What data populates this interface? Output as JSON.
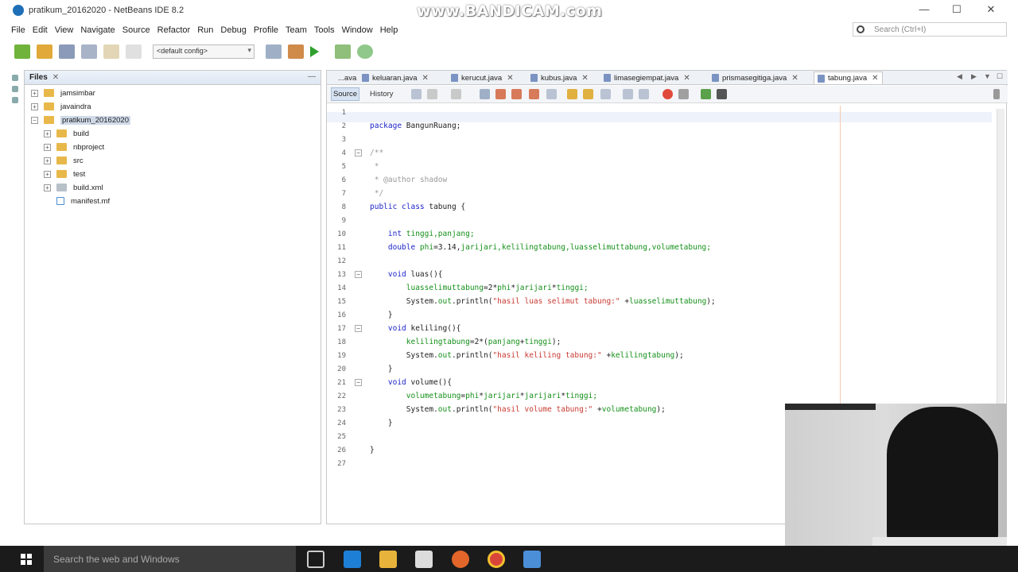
{
  "window": {
    "title": "pratikum_20162020 - NetBeans IDE 8.2",
    "watermark": "www.BANDICAM.com",
    "controls": {
      "minimize": "—",
      "maximize": "☐",
      "close": "✕"
    }
  },
  "menu": [
    "File",
    "Edit",
    "View",
    "Navigate",
    "Source",
    "Refactor",
    "Run",
    "Debug",
    "Profile",
    "Team",
    "Tools",
    "Window",
    "Help"
  ],
  "search": {
    "placeholder": "Search (Ctrl+I)"
  },
  "toolbar": {
    "config": "<default config>"
  },
  "files_panel": {
    "tab_label": "Files",
    "close": "✕",
    "minimize": "—",
    "tree": [
      {
        "label": "jamsimbar",
        "level": 0,
        "type": "folder",
        "expander": "+"
      },
      {
        "label": "javaindra",
        "level": 0,
        "type": "folder",
        "expander": "+"
      },
      {
        "label": "pratikum_20162020",
        "level": 0,
        "type": "folder",
        "expander": "−",
        "selected": true
      },
      {
        "label": "build",
        "level": 1,
        "type": "folder",
        "expander": "+"
      },
      {
        "label": "nbproject",
        "level": 1,
        "type": "folder",
        "expander": "+"
      },
      {
        "label": "src",
        "level": 1,
        "type": "folder",
        "expander": "+"
      },
      {
        "label": "test",
        "level": 1,
        "type": "folder",
        "expander": "+"
      },
      {
        "label": "build.xml",
        "level": 1,
        "type": "xml",
        "expander": "+"
      },
      {
        "label": "manifest.mf",
        "level": 1,
        "type": "file",
        "expander": ""
      }
    ]
  },
  "editor": {
    "tabs": [
      {
        "label": "...ava",
        "active": false
      },
      {
        "label": "keluaran.java",
        "active": false
      },
      {
        "label": "kerucut.java",
        "active": false
      },
      {
        "label": "kubus.java",
        "active": false
      },
      {
        "label": "limasegiempat.java",
        "active": false
      },
      {
        "label": "prismasegitiga.java",
        "active": false
      },
      {
        "label": "tabung.java",
        "active": true
      }
    ],
    "view_tabs": {
      "source": "Source",
      "history": "History"
    },
    "lines": [
      {
        "n": "1",
        "tokens": []
      },
      {
        "n": "2",
        "tokens": [
          {
            "t": "package ",
            "c": "kw"
          },
          {
            "t": "BangunRuang;",
            "c": "plain"
          }
        ]
      },
      {
        "n": "3",
        "tokens": []
      },
      {
        "n": "4",
        "fold": true,
        "tokens": [
          {
            "t": "/**",
            "c": "cm"
          }
        ]
      },
      {
        "n": "5",
        "tokens": [
          {
            "t": " *",
            "c": "cm"
          }
        ]
      },
      {
        "n": "6",
        "tokens": [
          {
            "t": " * @author shadow",
            "c": "cm"
          }
        ]
      },
      {
        "n": "7",
        "tokens": [
          {
            "t": " */",
            "c": "cm"
          }
        ]
      },
      {
        "n": "8",
        "tokens": [
          {
            "t": "public class ",
            "c": "kw"
          },
          {
            "t": "tabung {",
            "c": "plain"
          }
        ]
      },
      {
        "n": "9",
        "tokens": []
      },
      {
        "n": "10",
        "tokens": [
          {
            "t": "    int ",
            "c": "kw"
          },
          {
            "t": "tinggi,panjang;",
            "c": "fld"
          }
        ]
      },
      {
        "n": "11",
        "tokens": [
          {
            "t": "    double ",
            "c": "kw"
          },
          {
            "t": "phi",
            "c": "fld"
          },
          {
            "t": "=3.14,",
            "c": "plain"
          },
          {
            "t": "jarijari,kelilingtabung,luasselimuttabung,volumetabung;",
            "c": "fld"
          }
        ]
      },
      {
        "n": "12",
        "tokens": []
      },
      {
        "n": "13",
        "fold": true,
        "tokens": [
          {
            "t": "    void ",
            "c": "kw"
          },
          {
            "t": "luas(){",
            "c": "plain"
          }
        ]
      },
      {
        "n": "14",
        "tokens": [
          {
            "t": "        luasselimuttabung",
            "c": "fld"
          },
          {
            "t": "=2*",
            "c": "plain"
          },
          {
            "t": "phi",
            "c": "fld"
          },
          {
            "t": "*",
            "c": "plain"
          },
          {
            "t": "jarijari",
            "c": "fld"
          },
          {
            "t": "*",
            "c": "plain"
          },
          {
            "t": "tinggi;",
            "c": "fld"
          }
        ]
      },
      {
        "n": "15",
        "tokens": [
          {
            "t": "        System.",
            "c": "plain"
          },
          {
            "t": "out",
            "c": "fld"
          },
          {
            "t": ".println(",
            "c": "plain"
          },
          {
            "t": "\"hasil luas selimut tabung:\"",
            "c": "str"
          },
          {
            "t": " +",
            "c": "plain"
          },
          {
            "t": "luasselimuttabung",
            "c": "fld"
          },
          {
            "t": ");",
            "c": "plain"
          }
        ]
      },
      {
        "n": "16",
        "tokens": [
          {
            "t": "    }",
            "c": "plain"
          }
        ]
      },
      {
        "n": "17",
        "fold": true,
        "tokens": [
          {
            "t": "    void ",
            "c": "kw"
          },
          {
            "t": "keliling(){",
            "c": "plain"
          }
        ]
      },
      {
        "n": "18",
        "tokens": [
          {
            "t": "        kelilingtabung",
            "c": "fld"
          },
          {
            "t": "=2*(",
            "c": "plain"
          },
          {
            "t": "panjang",
            "c": "fld"
          },
          {
            "t": "+",
            "c": "plain"
          },
          {
            "t": "tinggi",
            "c": "fld"
          },
          {
            "t": ");",
            "c": "plain"
          }
        ]
      },
      {
        "n": "19",
        "tokens": [
          {
            "t": "        System.",
            "c": "plain"
          },
          {
            "t": "out",
            "c": "fld"
          },
          {
            "t": ".println(",
            "c": "plain"
          },
          {
            "t": "\"hasil keliling tabung:\"",
            "c": "str"
          },
          {
            "t": " +",
            "c": "plain"
          },
          {
            "t": "kelilingtabung",
            "c": "fld"
          },
          {
            "t": ");",
            "c": "plain"
          }
        ]
      },
      {
        "n": "20",
        "tokens": [
          {
            "t": "    }",
            "c": "plain"
          }
        ]
      },
      {
        "n": "21",
        "fold": true,
        "tokens": [
          {
            "t": "    void ",
            "c": "kw"
          },
          {
            "t": "volume(){",
            "c": "plain"
          }
        ]
      },
      {
        "n": "22",
        "tokens": [
          {
            "t": "        volumetabung",
            "c": "fld"
          },
          {
            "t": "=",
            "c": "plain"
          },
          {
            "t": "phi",
            "c": "fld"
          },
          {
            "t": "*",
            "c": "plain"
          },
          {
            "t": "jarijari",
            "c": "fld"
          },
          {
            "t": "*",
            "c": "plain"
          },
          {
            "t": "jarijari",
            "c": "fld"
          },
          {
            "t": "*",
            "c": "plain"
          },
          {
            "t": "tinggi;",
            "c": "fld"
          }
        ]
      },
      {
        "n": "23",
        "tokens": [
          {
            "t": "        System.",
            "c": "plain"
          },
          {
            "t": "out",
            "c": "fld"
          },
          {
            "t": ".println(",
            "c": "plain"
          },
          {
            "t": "\"hasil volume tabung:\"",
            "c": "str"
          },
          {
            "t": " +",
            "c": "plain"
          },
          {
            "t": "volumetabung",
            "c": "fld"
          },
          {
            "t": ");",
            "c": "plain"
          }
        ]
      },
      {
        "n": "24",
        "tokens": [
          {
            "t": "    }",
            "c": "plain"
          }
        ]
      },
      {
        "n": "25",
        "tokens": []
      },
      {
        "n": "26",
        "tokens": [
          {
            "t": "}",
            "c": "plain"
          }
        ]
      },
      {
        "n": "27",
        "tokens": []
      }
    ]
  },
  "taskbar": {
    "search_placeholder": "Search the web and Windows",
    "apps": [
      "task-view-icon",
      "edge-icon",
      "file-explorer-icon",
      "store-icon",
      "firefox-icon",
      "chrome-icon",
      "netbeans-icon"
    ]
  },
  "colors": {
    "keyword": "#1b24c8",
    "comment": "#9a9a9a",
    "field": "#15901a",
    "string": "#c83a32",
    "accent": "#1f6fb8"
  }
}
